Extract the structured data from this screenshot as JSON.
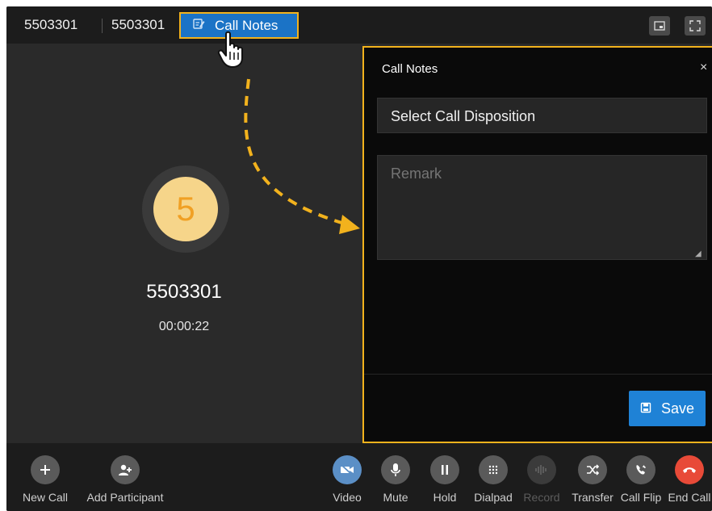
{
  "header": {
    "number_primary": "5503301",
    "number_secondary": "5503301",
    "call_notes_label": "Call Notes"
  },
  "caller": {
    "avatar_letter": "5",
    "number": "5503301",
    "duration": "00:00:22"
  },
  "notes_panel": {
    "title": "Call Notes",
    "close": "×",
    "disposition_placeholder": "Select Call Disposition",
    "remark_placeholder": "Remark",
    "save_label": "Save"
  },
  "toolbar": {
    "new_call": "New Call",
    "add_participant": "Add Participant",
    "video": "Video",
    "mute": "Mute",
    "hold": "Hold",
    "dialpad": "Dialpad",
    "record": "Record",
    "transfer": "Transfer",
    "call_flip": "Call Flip",
    "end_call": "End Call"
  },
  "colors": {
    "highlight": "#f2b21d",
    "primary_blue": "#1b73c6",
    "avatar_bg": "#f6d58a",
    "end_call_red": "#e84a38"
  }
}
